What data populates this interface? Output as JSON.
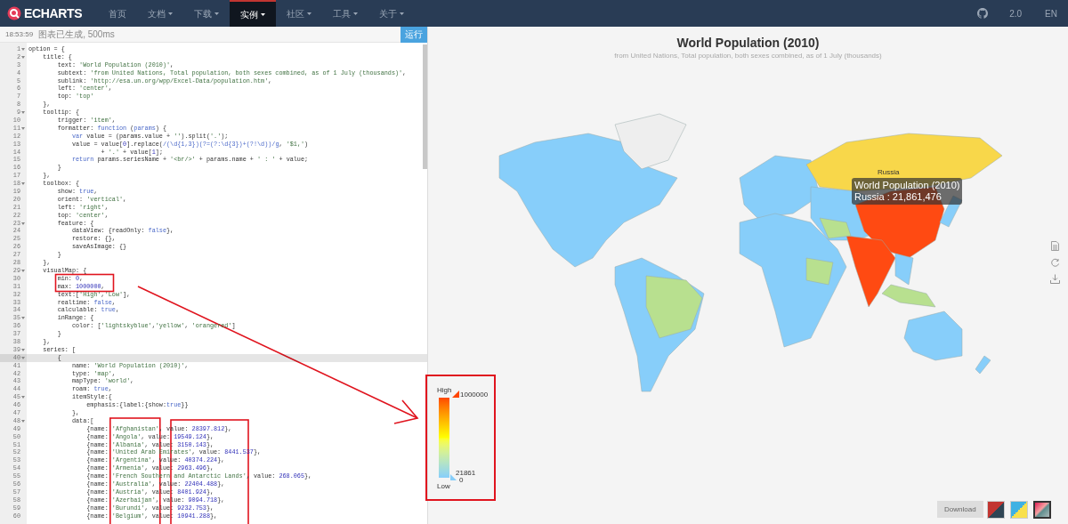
{
  "nav": {
    "logo": "ECHARTS",
    "items": [
      {
        "label": "首页",
        "dropdown": false,
        "selected": false
      },
      {
        "label": "文档",
        "dropdown": true,
        "selected": false
      },
      {
        "label": "下载",
        "dropdown": true,
        "selected": false
      },
      {
        "label": "实例",
        "dropdown": true,
        "selected": true
      },
      {
        "label": "社区",
        "dropdown": true,
        "selected": false
      },
      {
        "label": "工具",
        "dropdown": true,
        "selected": false
      },
      {
        "label": "关于",
        "dropdown": true,
        "selected": false
      }
    ],
    "version": "2.0",
    "language": "EN"
  },
  "editor": {
    "status_time": "18:53:59",
    "status_message": "图表已生成, 500ms",
    "run_button": "运行",
    "lines": [
      {
        "number": "1",
        "fold": true,
        "selected": false,
        "tokens": [
          {
            "kind": "plain",
            "text": "option = {"
          }
        ]
      },
      {
        "number": "2",
        "fold": true,
        "selected": false,
        "tokens": [
          {
            "kind": "plain",
            "text": "    title: {"
          }
        ]
      },
      {
        "number": "3",
        "fold": false,
        "selected": false,
        "tokens": [
          {
            "kind": "plain",
            "text": "        text: "
          },
          {
            "kind": "string",
            "text": "'World Population (2010)'"
          },
          {
            "kind": "plain",
            "text": ","
          }
        ]
      },
      {
        "number": "4",
        "fold": false,
        "selected": false,
        "tokens": [
          {
            "kind": "plain",
            "text": "        subtext: "
          },
          {
            "kind": "string",
            "text": "'from United Nations, Total population, both sexes combined, as of 1 July (thousands)'"
          },
          {
            "kind": "plain",
            "text": ","
          }
        ]
      },
      {
        "number": "5",
        "fold": false,
        "selected": false,
        "tokens": [
          {
            "kind": "plain",
            "text": "        sublink: "
          },
          {
            "kind": "string",
            "text": "'http://esa.un.org/wpp/Excel-Data/population.htm'"
          },
          {
            "kind": "plain",
            "text": ","
          }
        ]
      },
      {
        "number": "6",
        "fold": false,
        "selected": false,
        "tokens": [
          {
            "kind": "plain",
            "text": "        left: "
          },
          {
            "kind": "string",
            "text": "'center'"
          },
          {
            "kind": "plain",
            "text": ","
          }
        ]
      },
      {
        "number": "7",
        "fold": false,
        "selected": false,
        "tokens": [
          {
            "kind": "plain",
            "text": "        top: "
          },
          {
            "kind": "string",
            "text": "'top'"
          }
        ]
      },
      {
        "number": "8",
        "fold": false,
        "selected": false,
        "tokens": [
          {
            "kind": "plain",
            "text": "    },"
          }
        ]
      },
      {
        "number": "9",
        "fold": true,
        "selected": false,
        "tokens": [
          {
            "kind": "plain",
            "text": "    tooltip: {"
          }
        ]
      },
      {
        "number": "10",
        "fold": false,
        "selected": false,
        "tokens": [
          {
            "kind": "plain",
            "text": "        trigger: "
          },
          {
            "kind": "string",
            "text": "'item'"
          },
          {
            "kind": "plain",
            "text": ","
          }
        ]
      },
      {
        "number": "11",
        "fold": true,
        "selected": false,
        "tokens": [
          {
            "kind": "plain",
            "text": "        formatter: "
          },
          {
            "kind": "keyword",
            "text": "function"
          },
          {
            "kind": "plain",
            "text": " ("
          },
          {
            "kind": "keyword",
            "text": "params"
          },
          {
            "kind": "plain",
            "text": ") {"
          }
        ]
      },
      {
        "number": "12",
        "fold": false,
        "selected": false,
        "tokens": [
          {
            "kind": "keyword",
            "text": "            var"
          },
          {
            "kind": "plain",
            "text": " value = (params.value + "
          },
          {
            "kind": "string",
            "text": "''"
          },
          {
            "kind": "plain",
            "text": ").split("
          },
          {
            "kind": "string",
            "text": "'.'"
          },
          {
            "kind": "plain",
            "text": ");"
          }
        ]
      },
      {
        "number": "13",
        "fold": false,
        "selected": false,
        "tokens": [
          {
            "kind": "plain",
            "text": "            value = value["
          },
          {
            "kind": "number",
            "text": "0"
          },
          {
            "kind": "plain",
            "text": "].replace("
          },
          {
            "kind": "regex",
            "text": "/(\\d{1,3})(?=(?:\\d{3})+(?!\\d))/g"
          },
          {
            "kind": "plain",
            "text": ", "
          },
          {
            "kind": "string",
            "text": "'$1,'"
          },
          {
            "kind": "plain",
            "text": ")"
          }
        ]
      },
      {
        "number": "14",
        "fold": false,
        "selected": false,
        "tokens": [
          {
            "kind": "plain",
            "text": "                    + "
          },
          {
            "kind": "string",
            "text": "'.'"
          },
          {
            "kind": "plain",
            "text": " + value["
          },
          {
            "kind": "number",
            "text": "1"
          },
          {
            "kind": "plain",
            "text": "];"
          }
        ]
      },
      {
        "number": "15",
        "fold": false,
        "selected": false,
        "tokens": [
          {
            "kind": "keyword",
            "text": "            return"
          },
          {
            "kind": "plain",
            "text": " params.seriesName + "
          },
          {
            "kind": "string",
            "text": "'<br/>'"
          },
          {
            "kind": "plain",
            "text": " + params.name + "
          },
          {
            "kind": "string",
            "text": "' : '"
          },
          {
            "kind": "plain",
            "text": " + value;"
          }
        ]
      },
      {
        "number": "16",
        "fold": false,
        "selected": false,
        "tokens": [
          {
            "kind": "plain",
            "text": "        }"
          }
        ]
      },
      {
        "number": "17",
        "fold": false,
        "selected": false,
        "tokens": [
          {
            "kind": "plain",
            "text": "    },"
          }
        ]
      },
      {
        "number": "18",
        "fold": true,
        "selected": false,
        "tokens": [
          {
            "kind": "plain",
            "text": "    toolbox: {"
          }
        ]
      },
      {
        "number": "19",
        "fold": false,
        "selected": false,
        "tokens": [
          {
            "kind": "plain",
            "text": "        show: "
          },
          {
            "kind": "keyword",
            "text": "true"
          },
          {
            "kind": "plain",
            "text": ","
          }
        ]
      },
      {
        "number": "20",
        "fold": false,
        "selected": false,
        "tokens": [
          {
            "kind": "plain",
            "text": "        orient: "
          },
          {
            "kind": "string",
            "text": "'vertical'"
          },
          {
            "kind": "plain",
            "text": ","
          }
        ]
      },
      {
        "number": "21",
        "fold": false,
        "selected": false,
        "tokens": [
          {
            "kind": "plain",
            "text": "        left: "
          },
          {
            "kind": "string",
            "text": "'right'"
          },
          {
            "kind": "plain",
            "text": ","
          }
        ]
      },
      {
        "number": "22",
        "fold": false,
        "selected": false,
        "tokens": [
          {
            "kind": "plain",
            "text": "        top: "
          },
          {
            "kind": "string",
            "text": "'center'"
          },
          {
            "kind": "plain",
            "text": ","
          }
        ]
      },
      {
        "number": "23",
        "fold": true,
        "selected": false,
        "tokens": [
          {
            "kind": "plain",
            "text": "        feature: {"
          }
        ]
      },
      {
        "number": "24",
        "fold": false,
        "selected": false,
        "tokens": [
          {
            "kind": "plain",
            "text": "            dataView: {readOnly: "
          },
          {
            "kind": "keyword",
            "text": "false"
          },
          {
            "kind": "plain",
            "text": "},"
          }
        ]
      },
      {
        "number": "25",
        "fold": false,
        "selected": false,
        "tokens": [
          {
            "kind": "plain",
            "text": "            restore: {},"
          }
        ]
      },
      {
        "number": "26",
        "fold": false,
        "selected": false,
        "tokens": [
          {
            "kind": "plain",
            "text": "            saveAsImage: {}"
          }
        ]
      },
      {
        "number": "27",
        "fold": false,
        "selected": false,
        "tokens": [
          {
            "kind": "plain",
            "text": "        }"
          }
        ]
      },
      {
        "number": "28",
        "fold": false,
        "selected": false,
        "tokens": [
          {
            "kind": "plain",
            "text": "    },"
          }
        ]
      },
      {
        "number": "29",
        "fold": true,
        "selected": false,
        "tokens": [
          {
            "kind": "plain",
            "text": "    visualMap: {"
          }
        ]
      },
      {
        "number": "30",
        "fold": false,
        "selected": false,
        "tokens": [
          {
            "kind": "plain",
            "text": "        min: "
          },
          {
            "kind": "number",
            "text": "0"
          },
          {
            "kind": "plain",
            "text": ","
          }
        ]
      },
      {
        "number": "31",
        "fold": false,
        "selected": false,
        "tokens": [
          {
            "kind": "plain",
            "text": "        max: "
          },
          {
            "kind": "number",
            "text": "1000000"
          },
          {
            "kind": "plain",
            "text": ","
          }
        ]
      },
      {
        "number": "32",
        "fold": false,
        "selected": false,
        "tokens": [
          {
            "kind": "plain",
            "text": "        text:["
          },
          {
            "kind": "string",
            "text": "'High'"
          },
          {
            "kind": "plain",
            "text": ","
          },
          {
            "kind": "string",
            "text": "'Low'"
          },
          {
            "kind": "plain",
            "text": "],"
          }
        ]
      },
      {
        "number": "33",
        "fold": false,
        "selected": false,
        "tokens": [
          {
            "kind": "plain",
            "text": "        realtime: "
          },
          {
            "kind": "keyword",
            "text": "false"
          },
          {
            "kind": "plain",
            "text": ","
          }
        ]
      },
      {
        "number": "34",
        "fold": false,
        "selected": false,
        "tokens": [
          {
            "kind": "plain",
            "text": "        calculable: "
          },
          {
            "kind": "keyword",
            "text": "true"
          },
          {
            "kind": "plain",
            "text": ","
          }
        ]
      },
      {
        "number": "35",
        "fold": true,
        "selected": false,
        "tokens": [
          {
            "kind": "plain",
            "text": "        inRange: {"
          }
        ]
      },
      {
        "number": "36",
        "fold": false,
        "selected": false,
        "tokens": [
          {
            "kind": "plain",
            "text": "            color: ["
          },
          {
            "kind": "string",
            "text": "'lightskyblue'"
          },
          {
            "kind": "plain",
            "text": ","
          },
          {
            "kind": "string",
            "text": "'yellow'"
          },
          {
            "kind": "plain",
            "text": ", "
          },
          {
            "kind": "string",
            "text": "'orangered'"
          },
          {
            "kind": "plain",
            "text": "]"
          }
        ]
      },
      {
        "number": "37",
        "fold": false,
        "selected": false,
        "tokens": [
          {
            "kind": "plain",
            "text": "        }"
          }
        ]
      },
      {
        "number": "38",
        "fold": false,
        "selected": false,
        "tokens": [
          {
            "kind": "plain",
            "text": "    },"
          }
        ]
      },
      {
        "number": "39",
        "fold": true,
        "selected": false,
        "tokens": [
          {
            "kind": "plain",
            "text": "    series: ["
          }
        ]
      },
      {
        "number": "40",
        "fold": true,
        "selected": true,
        "tokens": [
          {
            "kind": "plain",
            "text": "        {"
          }
        ]
      },
      {
        "number": "41",
        "fold": false,
        "selected": false,
        "tokens": [
          {
            "kind": "plain",
            "text": "            name: "
          },
          {
            "kind": "string",
            "text": "'World Population (2010)'"
          },
          {
            "kind": "plain",
            "text": ","
          }
        ]
      },
      {
        "number": "42",
        "fold": false,
        "selected": false,
        "tokens": [
          {
            "kind": "plain",
            "text": "            type: "
          },
          {
            "kind": "string",
            "text": "'map'"
          },
          {
            "kind": "plain",
            "text": ","
          }
        ]
      },
      {
        "number": "43",
        "fold": false,
        "selected": false,
        "tokens": [
          {
            "kind": "plain",
            "text": "            mapType: "
          },
          {
            "kind": "string",
            "text": "'world'"
          },
          {
            "kind": "plain",
            "text": ","
          }
        ]
      },
      {
        "number": "44",
        "fold": false,
        "selected": false,
        "tokens": [
          {
            "kind": "plain",
            "text": "            roam: "
          },
          {
            "kind": "keyword",
            "text": "true"
          },
          {
            "kind": "plain",
            "text": ","
          }
        ]
      },
      {
        "number": "45",
        "fold": true,
        "selected": false,
        "tokens": [
          {
            "kind": "plain",
            "text": "            itemStyle:{"
          }
        ]
      },
      {
        "number": "46",
        "fold": false,
        "selected": false,
        "tokens": [
          {
            "kind": "plain",
            "text": "                emphasis:{label:{show:"
          },
          {
            "kind": "keyword",
            "text": "true"
          },
          {
            "kind": "plain",
            "text": "}}"
          }
        ]
      },
      {
        "number": "47",
        "fold": false,
        "selected": false,
        "tokens": [
          {
            "kind": "plain",
            "text": "            },"
          }
        ]
      },
      {
        "number": "48",
        "fold": true,
        "selected": false,
        "tokens": [
          {
            "kind": "plain",
            "text": "            data:["
          }
        ]
      },
      {
        "number": "49",
        "fold": false,
        "selected": false,
        "tokens": [
          {
            "kind": "plain",
            "text": "                {name: "
          },
          {
            "kind": "string",
            "text": "'Afghanistan'"
          },
          {
            "kind": "plain",
            "text": ", value: "
          },
          {
            "kind": "number",
            "text": "28397.812"
          },
          {
            "kind": "plain",
            "text": "},"
          }
        ]
      },
      {
        "number": "50",
        "fold": false,
        "selected": false,
        "tokens": [
          {
            "kind": "plain",
            "text": "                {name: "
          },
          {
            "kind": "string",
            "text": "'Angola'"
          },
          {
            "kind": "plain",
            "text": ", value: "
          },
          {
            "kind": "number",
            "text": "19549.124"
          },
          {
            "kind": "plain",
            "text": "},"
          }
        ]
      },
      {
        "number": "51",
        "fold": false,
        "selected": false,
        "tokens": [
          {
            "kind": "plain",
            "text": "                {name: "
          },
          {
            "kind": "string",
            "text": "'Albania'"
          },
          {
            "kind": "plain",
            "text": ", value: "
          },
          {
            "kind": "number",
            "text": "3150.143"
          },
          {
            "kind": "plain",
            "text": "},"
          }
        ]
      },
      {
        "number": "52",
        "fold": false,
        "selected": false,
        "tokens": [
          {
            "kind": "plain",
            "text": "                {name: "
          },
          {
            "kind": "string",
            "text": "'United Arab Emirates'"
          },
          {
            "kind": "plain",
            "text": ", value: "
          },
          {
            "kind": "number",
            "text": "8441.537"
          },
          {
            "kind": "plain",
            "text": "},"
          }
        ]
      },
      {
        "number": "53",
        "fold": false,
        "selected": false,
        "tokens": [
          {
            "kind": "plain",
            "text": "                {name: "
          },
          {
            "kind": "string",
            "text": "'Argentina'"
          },
          {
            "kind": "plain",
            "text": ", value: "
          },
          {
            "kind": "number",
            "text": "40374.224"
          },
          {
            "kind": "plain",
            "text": "},"
          }
        ]
      },
      {
        "number": "54",
        "fold": false,
        "selected": false,
        "tokens": [
          {
            "kind": "plain",
            "text": "                {name: "
          },
          {
            "kind": "string",
            "text": "'Armenia'"
          },
          {
            "kind": "plain",
            "text": ", value: "
          },
          {
            "kind": "number",
            "text": "2963.496"
          },
          {
            "kind": "plain",
            "text": "},"
          }
        ]
      },
      {
        "number": "55",
        "fold": false,
        "selected": false,
        "tokens": [
          {
            "kind": "plain",
            "text": "                {name: "
          },
          {
            "kind": "string",
            "text": "'French Southern and Antarctic Lands'"
          },
          {
            "kind": "plain",
            "text": ", value: "
          },
          {
            "kind": "number",
            "text": "268.065"
          },
          {
            "kind": "plain",
            "text": "},"
          }
        ]
      },
      {
        "number": "56",
        "fold": false,
        "selected": false,
        "tokens": [
          {
            "kind": "plain",
            "text": "                {name: "
          },
          {
            "kind": "string",
            "text": "'Australia'"
          },
          {
            "kind": "plain",
            "text": ", value: "
          },
          {
            "kind": "number",
            "text": "22404.488"
          },
          {
            "kind": "plain",
            "text": "},"
          }
        ]
      },
      {
        "number": "57",
        "fold": false,
        "selected": false,
        "tokens": [
          {
            "kind": "plain",
            "text": "                {name: "
          },
          {
            "kind": "string",
            "text": "'Austria'"
          },
          {
            "kind": "plain",
            "text": ", value: "
          },
          {
            "kind": "number",
            "text": "8401.924"
          },
          {
            "kind": "plain",
            "text": "},"
          }
        ]
      },
      {
        "number": "58",
        "fold": false,
        "selected": false,
        "tokens": [
          {
            "kind": "plain",
            "text": "                {name: "
          },
          {
            "kind": "string",
            "text": "'Azerbaijan'"
          },
          {
            "kind": "plain",
            "text": ", value: "
          },
          {
            "kind": "number",
            "text": "9094.718"
          },
          {
            "kind": "plain",
            "text": "},"
          }
        ]
      },
      {
        "number": "59",
        "fold": false,
        "selected": false,
        "tokens": [
          {
            "kind": "plain",
            "text": "                {name: "
          },
          {
            "kind": "string",
            "text": "'Burundi'"
          },
          {
            "kind": "plain",
            "text": ", value: "
          },
          {
            "kind": "number",
            "text": "9232.753"
          },
          {
            "kind": "plain",
            "text": "},"
          }
        ]
      },
      {
        "number": "60",
        "fold": false,
        "selected": false,
        "tokens": [
          {
            "kind": "plain",
            "text": "                {name: "
          },
          {
            "kind": "string",
            "text": "'Belgium'"
          },
          {
            "kind": "plain",
            "text": ", value: "
          },
          {
            "kind": "number",
            "text": "10941.288"
          },
          {
            "kind": "plain",
            "text": "},"
          }
        ]
      }
    ]
  },
  "chart": {
    "title": "World Population (2010)",
    "subtitle": "from United Nations, Total population, both sexes combined, as of 1 July (thousands)",
    "map_label": "Russia",
    "tooltip": {
      "series": "World Population (2010)",
      "item": "Russia : 21,861,476"
    },
    "visual_map": {
      "high": "High",
      "max": "1000000",
      "handle_value": "21861",
      "min": "0",
      "low": "Low"
    },
    "download_button": "Download",
    "themes": [
      {
        "selected": false
      },
      {
        "selected": false
      },
      {
        "selected": true
      }
    ]
  }
}
